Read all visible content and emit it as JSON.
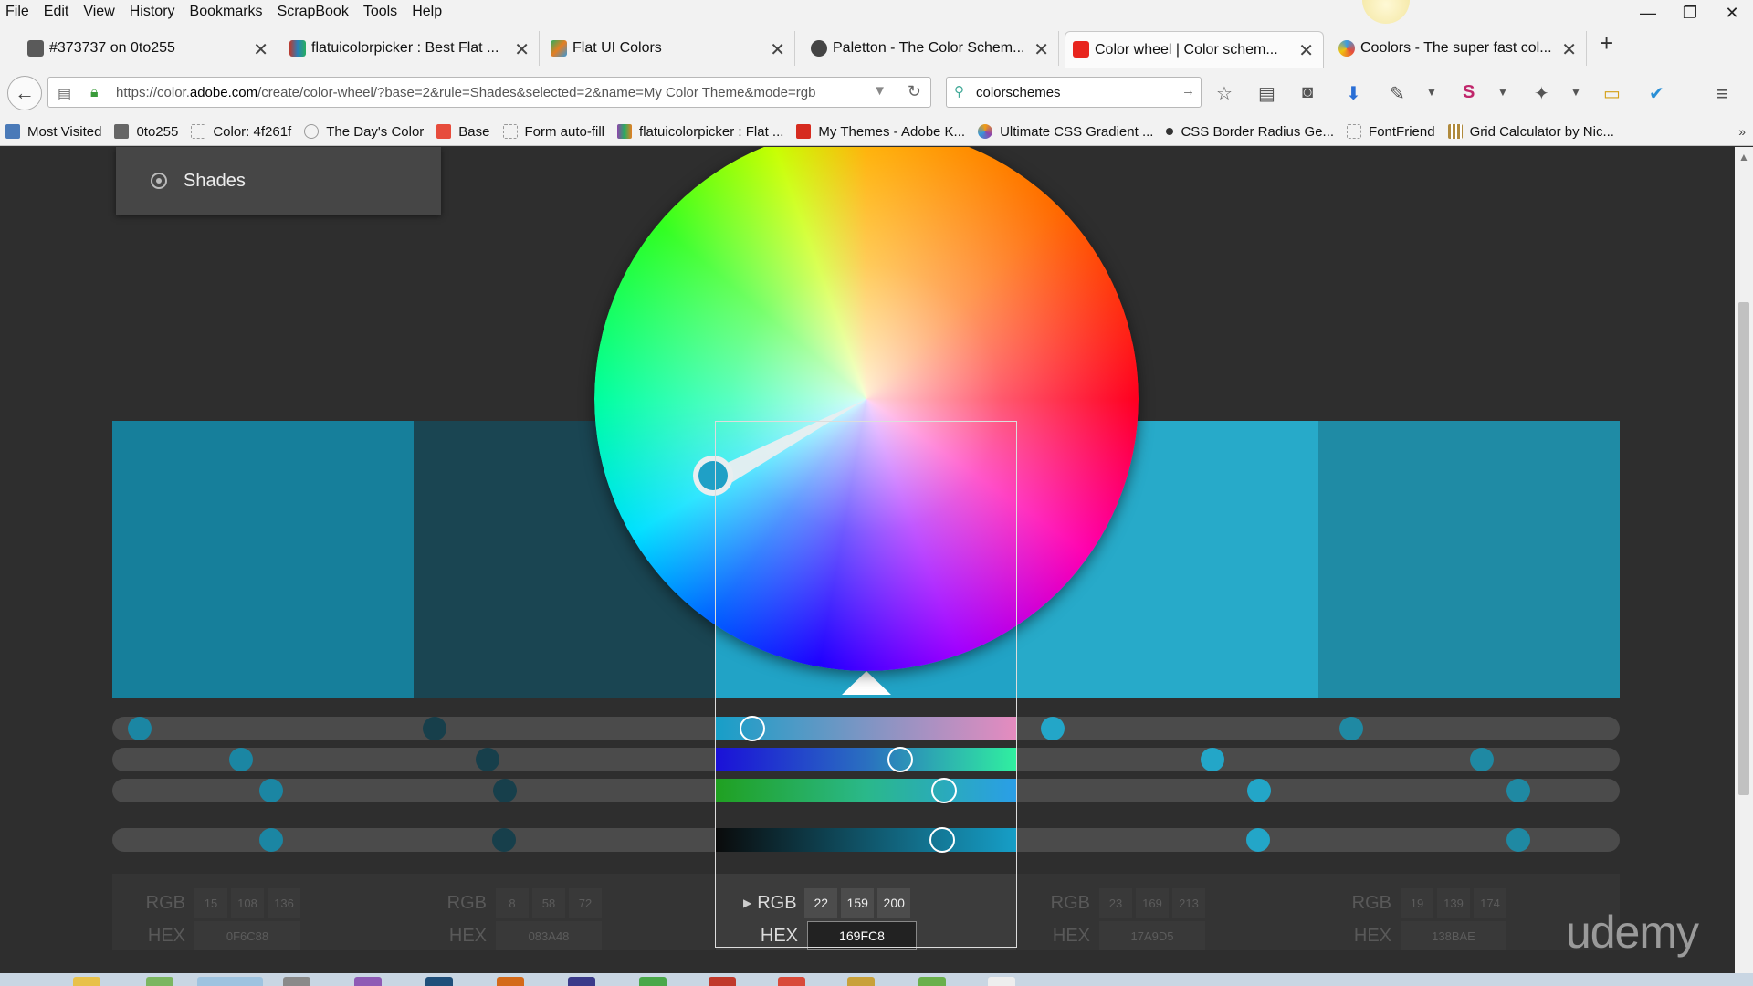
{
  "menu": [
    "File",
    "Edit",
    "View",
    "History",
    "Bookmarks",
    "ScrapBook",
    "Tools",
    "Help"
  ],
  "window_controls": {
    "minimize": "—",
    "restore": "❐",
    "close": "✕"
  },
  "tabs": [
    {
      "title": "#373737 on 0to255",
      "fav_color": "#5a5a5a",
      "active": false
    },
    {
      "title": "flatuicolorpicker : Best Flat ...",
      "fav_color": "#c0392b",
      "active": false
    },
    {
      "title": "Flat UI Colors",
      "fav_color": "#27ae60",
      "active": false
    },
    {
      "title": "Paletton - The Color Schem...",
      "fav_color": "#444444",
      "active": false
    },
    {
      "title": "Color wheel | Color schem...",
      "fav_color": "#e8251e",
      "active": true
    },
    {
      "title": "Coolors - The super fast col...",
      "fav_color": "#3c9be0",
      "active": false
    }
  ],
  "new_tab": "+",
  "url": {
    "prefix": "https://color.",
    "domain": "adobe.com",
    "rest": "/create/color-wheel/?base=2&rule=Shades&selected=2&name=My Color Theme&mode=rgb"
  },
  "search": {
    "value": "colorschemes"
  },
  "bookmarks": [
    {
      "label": "Most Visited",
      "color": "#4a7ab8"
    },
    {
      "label": "0to255",
      "color": "#666666"
    },
    {
      "label": "Color: 4f261f",
      "color": "#ffffff"
    },
    {
      "label": "The Day's Color",
      "color": "#bbbbbb"
    },
    {
      "label": "Base",
      "color": "#e74c3c"
    },
    {
      "label": "Form auto-fill",
      "color": "#ffffff"
    },
    {
      "label": "flatuicolorpicker : Flat ...",
      "color": "#8e44ad"
    },
    {
      "label": "My Themes - Adobe K...",
      "color": "#d62b1f"
    },
    {
      "label": "Ultimate CSS Gradient ...",
      "color": "#f39c12"
    },
    {
      "label": "CSS Border Radius Ge...",
      "color": "#333333"
    },
    {
      "label": "FontFriend",
      "color": "#ffffff"
    },
    {
      "label": "Grid Calculator by Nic...",
      "color": "#b08a3c"
    }
  ],
  "rule_menu": {
    "label": "Shades"
  },
  "swatches": [
    {
      "color": "#0F6C88",
      "rgb": [
        "15",
        "108",
        "136"
      ],
      "hex": "0F6C88",
      "selected": false
    },
    {
      "color": "#083A48",
      "rgb": [
        "8",
        "58",
        "72"
      ],
      "hex": "083A48",
      "selected": false
    },
    {
      "color": "#169FC8",
      "rgb": [
        "22",
        "159",
        "200"
      ],
      "hex": "169FC8",
      "selected": true
    },
    {
      "color": "#17A9D5",
      "rgb": [
        "23",
        "169",
        "213"
      ],
      "hex": "17A9D5",
      "selected": false
    },
    {
      "color": "#138BAE",
      "rgb": [
        "19",
        "139",
        "174"
      ],
      "hex": "138BAE",
      "selected": false
    }
  ],
  "labels": {
    "rgb": "RGB",
    "hex": "HEX"
  },
  "watermark": "udemy"
}
